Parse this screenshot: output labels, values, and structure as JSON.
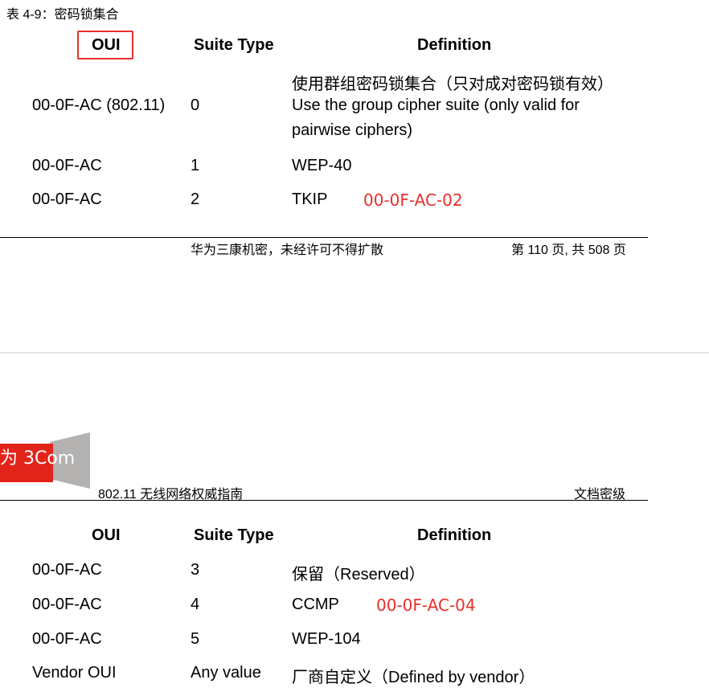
{
  "page1": {
    "caption": "表 4-9：密码锁集合",
    "headers": {
      "oui": "OUI",
      "suite_type": "Suite Type",
      "definition": "Definition"
    },
    "rows": [
      {
        "oui": "00-0F-AC (802.11)",
        "type": "0",
        "def_lines": [
          "使用群组密码锁集合（只对成对密码锁有效）",
          "Use the group cipher suite (only valid for",
          "pairwise ciphers)"
        ]
      },
      {
        "oui": "00-0F-AC",
        "type": "1",
        "def": "WEP-40"
      },
      {
        "oui": "00-0F-AC",
        "type": "2",
        "def": "TKIP",
        "annotation": "00-0F-AC-02"
      }
    ],
    "footer": {
      "confidential": "华为三康机密，未经许可不得扩散",
      "page_info": "第 110 页, 共 508 页"
    }
  },
  "page2": {
    "logo_text": "为 3Com",
    "header_left": "802.11 无线网络权威指南",
    "header_right": "文档密级",
    "headers": {
      "oui": "OUI",
      "suite_type": "Suite Type",
      "definition": "Definition"
    },
    "rows": [
      {
        "oui": "00-0F-AC",
        "type": "3",
        "def": "保留（Reserved）"
      },
      {
        "oui": "00-0F-AC",
        "type": "4",
        "def": "CCMP",
        "annotation": "00-0F-AC-04"
      },
      {
        "oui": "00-0F-AC",
        "type": "5",
        "def": "WEP-104"
      },
      {
        "oui": "Vendor OUI",
        "type": "Any value",
        "def": "厂商自定义（Defined by vendor）"
      }
    ]
  },
  "colors": {
    "highlight": "#e8302a",
    "logo_red": "#e3241b",
    "logo_gray": "#b4b2b0"
  }
}
